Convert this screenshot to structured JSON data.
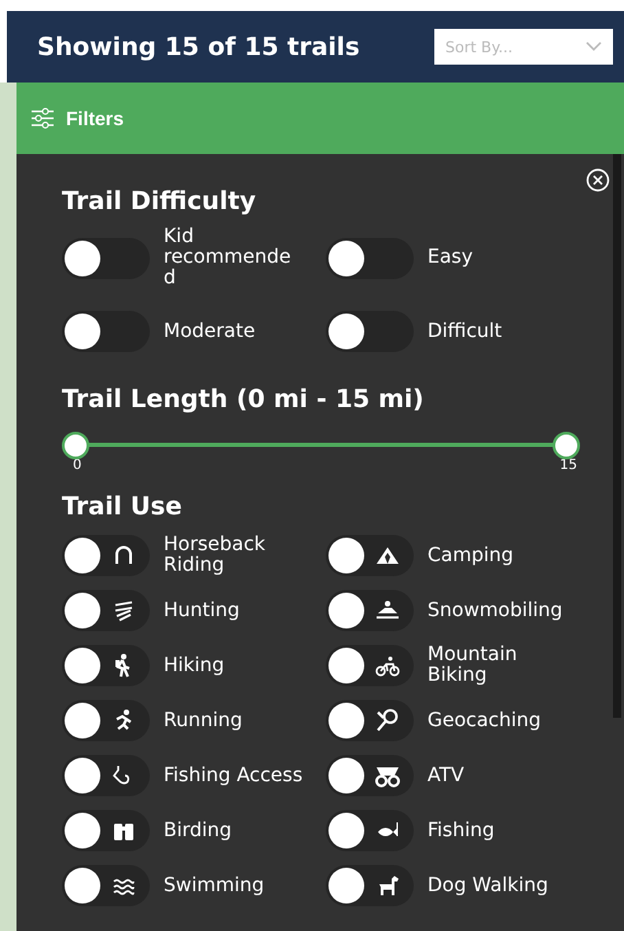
{
  "header": {
    "title": "Showing 15 of 15 trails",
    "sort": {
      "placeholder": "Sort By..."
    }
  },
  "filters_bar": {
    "label": "Filters"
  },
  "difficulty": {
    "title": "Trail Difficulty",
    "items": [
      {
        "label": "Kid recommended",
        "on": false
      },
      {
        "label": "Easy",
        "on": false
      },
      {
        "label": "Moderate",
        "on": false
      },
      {
        "label": "Difficult",
        "on": false
      }
    ]
  },
  "length": {
    "title": "Trail Length (0 mi - 15 mi)",
    "min_label": "0",
    "max_label": "15",
    "level": 1
  },
  "use": {
    "title": "Trail Use",
    "items": [
      {
        "label": "Horseback Riding",
        "on": false
      },
      {
        "label": "Camping",
        "on": false
      },
      {
        "label": "Hunting",
        "on": false
      },
      {
        "label": "Snowmobiling",
        "on": false
      },
      {
        "label": "Hiking",
        "on": false
      },
      {
        "label": "Mountain Biking",
        "on": false
      },
      {
        "label": "Running",
        "on": false
      },
      {
        "label": "Geocaching",
        "on": false
      },
      {
        "label": "Fishing Access",
        "on": false
      },
      {
        "label": "ATV",
        "on": false
      },
      {
        "label": "Birding",
        "on": false
      },
      {
        "label": "Fishing",
        "on": false
      },
      {
        "label": "Swimming",
        "on": false
      },
      {
        "label": "Dog Walking",
        "on": false
      }
    ]
  }
}
